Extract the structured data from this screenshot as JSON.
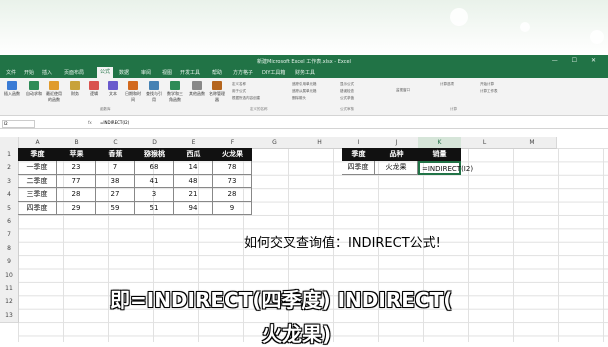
{
  "window": {
    "title": "新建Microsoft Excel 工作表.xlsx - Excel",
    "controls": "— ☐ ✕"
  },
  "tabs": [
    "文件",
    "开始",
    "插入",
    "页面布局",
    "公式",
    "数据",
    "审阅",
    "视图",
    "开发工具",
    "帮助",
    "方方格子",
    "DIY工具箱",
    "财务工具"
  ],
  "active_tab": "公式",
  "ribbon": {
    "buttons": [
      "插入函数",
      "自动求和",
      "最近使用的函数",
      "财务",
      "逻辑",
      "文本",
      "日期和时间",
      "查找与引用",
      "数学和三角函数",
      "其他函数",
      "名称管理器"
    ],
    "small_items": [
      "定义名称",
      "用于公式",
      "根据所选内容创建",
      "追踪引用单元格",
      "追踪从属单元格",
      "删除箭头",
      "显示公式",
      "错误检查",
      "公式求值",
      "监视窗口",
      "计算选项",
      "开始计算",
      "计算工作表"
    ],
    "groups": [
      "函数库",
      "定义的名称",
      "公式审核",
      "计算"
    ]
  },
  "formula_bar": {
    "name_box": "I2",
    "fx": "fx",
    "value": "=INDIRECT(I2)"
  },
  "columns": [
    "A",
    "B",
    "C",
    "D",
    "E",
    "F",
    "G",
    "H",
    "I",
    "J",
    "K",
    "L",
    "M"
  ],
  "rows": [
    "1",
    "2",
    "3",
    "4",
    "5",
    "6",
    "7",
    "8",
    "9",
    "10",
    "11",
    "12",
    "13"
  ],
  "table1": {
    "headers": [
      "季度",
      "苹果",
      "香蕉",
      "猕猴桃",
      "西瓜",
      "火龙果"
    ],
    "rows": [
      [
        "一季度",
        "23",
        "7",
        "68",
        "14",
        "78"
      ],
      [
        "二季度",
        "77",
        "38",
        "41",
        "48",
        "73"
      ],
      [
        "三季度",
        "28",
        "27",
        "3",
        "21",
        "28"
      ],
      [
        "四季度",
        "29",
        "59",
        "51",
        "94",
        "9"
      ]
    ]
  },
  "table2": {
    "headers": [
      "季度",
      "品种",
      "销量"
    ],
    "values": [
      "四季度",
      "火龙果",
      "=INDIRECT(I2)"
    ]
  },
  "caption": "如何交叉查询值：INDIRECT公式!",
  "subtitle": {
    "line1": "即=INDIRECT(四季度) INDIRECT(",
    "line2": "火龙果)"
  },
  "colors": {
    "excel_green": "#217346",
    "header_fill": "#111111"
  }
}
